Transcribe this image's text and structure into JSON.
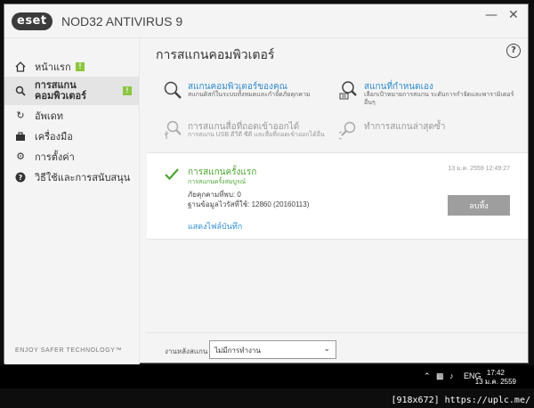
{
  "window": {
    "logo": "eset",
    "product_name": "NOD32 ANTIVIRUS 9",
    "minimize_icon": "minimize-icon",
    "close_icon": "close-icon"
  },
  "sidebar": {
    "items": [
      {
        "label": "หน้าแรก",
        "icon": "home-icon",
        "badge": "!"
      },
      {
        "label": "การสแกนคอมพิวเตอร์",
        "icon": "search-icon",
        "badge": "!",
        "active": true
      },
      {
        "label": "อัพเดท",
        "icon": "refresh-icon"
      },
      {
        "label": "เครื่องมือ",
        "icon": "toolbox-icon"
      },
      {
        "label": "การตั้งค่า",
        "icon": "gear-icon"
      },
      {
        "label": "วิธีใช้และการสนับสนุน",
        "icon": "help-icon"
      }
    ],
    "slogan": "ENJOY SAFER TECHNOLOGY™"
  },
  "main": {
    "title": "การสแกนคอมพิวเตอร์",
    "help_icon": "?",
    "options": [
      {
        "title": "สแกนคอมพิวเตอร์ของคุณ",
        "desc": "สแกนดิสก์ในระบบทั้งหมดและกำจัดภัยคุกคาม",
        "icon": "magnifier-icon"
      },
      {
        "title": "สแกนที่กำหนดเอง",
        "desc": "เลือกเป้าหมายการสแกน ระดับการกำจัดและพารามิเตอร์อื่นๆ",
        "icon": "custom-scan-icon"
      },
      {
        "title": "การสแกนสื่อที่ถอดเข้าออกได้",
        "desc": "การสแกน USB ดีวีดี ซีดี และสื่อที่ถอดเข้าออกได้อื่น",
        "icon": "usb-scan-icon",
        "disabled": true
      },
      {
        "title": "ทำการสแกนล่าสุดซ้ำ",
        "desc": "",
        "icon": "repeat-scan-icon",
        "disabled": true
      }
    ],
    "result": {
      "title": "การสแกนครั้งแรก",
      "subtitle": "การสแกนครั้งสมบูรณ์",
      "date": "13 ม.ค. 2559 12:49:27",
      "threats": "ภัยคุกคามที่พบ: 0",
      "db_version": "ฐานข้อมูลไวรัสที่ใช้: 12860 (20160113)",
      "log_link": "แสดงไฟล์บันทึก",
      "delete_label": "ลบทิ้ง"
    },
    "bottom": {
      "label": "งานหลังสแกน",
      "select_value": "ไม่มีการทำงาน"
    }
  },
  "taskbar": {
    "lang": "ENG",
    "time": "17:42",
    "date": "13 ม.ค. 2559",
    "footer": "[918x672] https://uplc.me/"
  }
}
